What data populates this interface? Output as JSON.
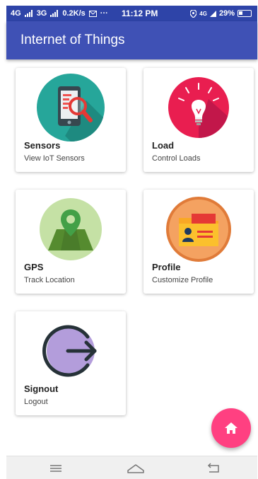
{
  "status_bar": {
    "network": "4G",
    "network2": "3G",
    "speed": "0.2K/s",
    "dots": "···",
    "time": "11:12 PM",
    "volte": "4G",
    "battery": "29%"
  },
  "app_bar": {
    "title": "Internet of Things"
  },
  "cards": [
    {
      "title": "Sensors",
      "subtitle": "View IoT Sensors",
      "icon": "sensor-phone-magnifier-icon"
    },
    {
      "title": "Load",
      "subtitle": "Control Loads",
      "icon": "light-bulb-icon"
    },
    {
      "title": "GPS",
      "subtitle": "Track Location",
      "icon": "map-pin-icon"
    },
    {
      "title": "Profile",
      "subtitle": "Customize Profile",
      "icon": "profile-folder-icon"
    },
    {
      "title": "Signout",
      "subtitle": "Logout",
      "icon": "logout-icon"
    }
  ],
  "fab": {
    "icon": "home-icon",
    "color": "#ff4081"
  },
  "nav_bar": {
    "icons": [
      "menu-icon",
      "home-outline-icon",
      "back-icon"
    ]
  },
  "colors": {
    "primary": "#3f51b5",
    "primary_dark": "#2e44a8",
    "accent": "#ff4081"
  }
}
